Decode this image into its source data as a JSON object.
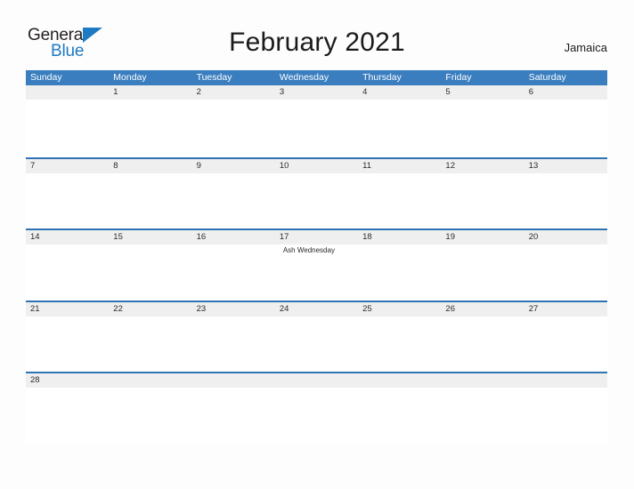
{
  "brand": {
    "name_line1": "General",
    "name_line2": "Blue",
    "flag_icon": "blue-triangle-flag",
    "color_dark": "#231f20",
    "color_blue": "#1f7ac4"
  },
  "header": {
    "title": "February 2021",
    "locale": "Jamaica"
  },
  "calendar": {
    "header_bg": "#3a7ebf",
    "row_line": "#2e74b5",
    "daynum_bg": "#efefef",
    "weekdays": [
      "Sunday",
      "Monday",
      "Tuesday",
      "Wednesday",
      "Thursday",
      "Friday",
      "Saturday"
    ],
    "weeks": [
      {
        "days": [
          {
            "num": "",
            "events": []
          },
          {
            "num": "1",
            "events": []
          },
          {
            "num": "2",
            "events": []
          },
          {
            "num": "3",
            "events": []
          },
          {
            "num": "4",
            "events": []
          },
          {
            "num": "5",
            "events": []
          },
          {
            "num": "6",
            "events": []
          }
        ]
      },
      {
        "days": [
          {
            "num": "7",
            "events": []
          },
          {
            "num": "8",
            "events": []
          },
          {
            "num": "9",
            "events": []
          },
          {
            "num": "10",
            "events": []
          },
          {
            "num": "11",
            "events": []
          },
          {
            "num": "12",
            "events": []
          },
          {
            "num": "13",
            "events": []
          }
        ]
      },
      {
        "days": [
          {
            "num": "14",
            "events": []
          },
          {
            "num": "15",
            "events": []
          },
          {
            "num": "16",
            "events": []
          },
          {
            "num": "17",
            "events": [
              "Ash Wednesday"
            ]
          },
          {
            "num": "18",
            "events": []
          },
          {
            "num": "19",
            "events": []
          },
          {
            "num": "20",
            "events": []
          }
        ]
      },
      {
        "days": [
          {
            "num": "21",
            "events": []
          },
          {
            "num": "22",
            "events": []
          },
          {
            "num": "23",
            "events": []
          },
          {
            "num": "24",
            "events": []
          },
          {
            "num": "25",
            "events": []
          },
          {
            "num": "26",
            "events": []
          },
          {
            "num": "27",
            "events": []
          }
        ]
      },
      {
        "days": [
          {
            "num": "28",
            "events": []
          },
          {
            "num": "",
            "events": []
          },
          {
            "num": "",
            "events": []
          },
          {
            "num": "",
            "events": []
          },
          {
            "num": "",
            "events": []
          },
          {
            "num": "",
            "events": []
          },
          {
            "num": "",
            "events": []
          }
        ]
      }
    ]
  }
}
